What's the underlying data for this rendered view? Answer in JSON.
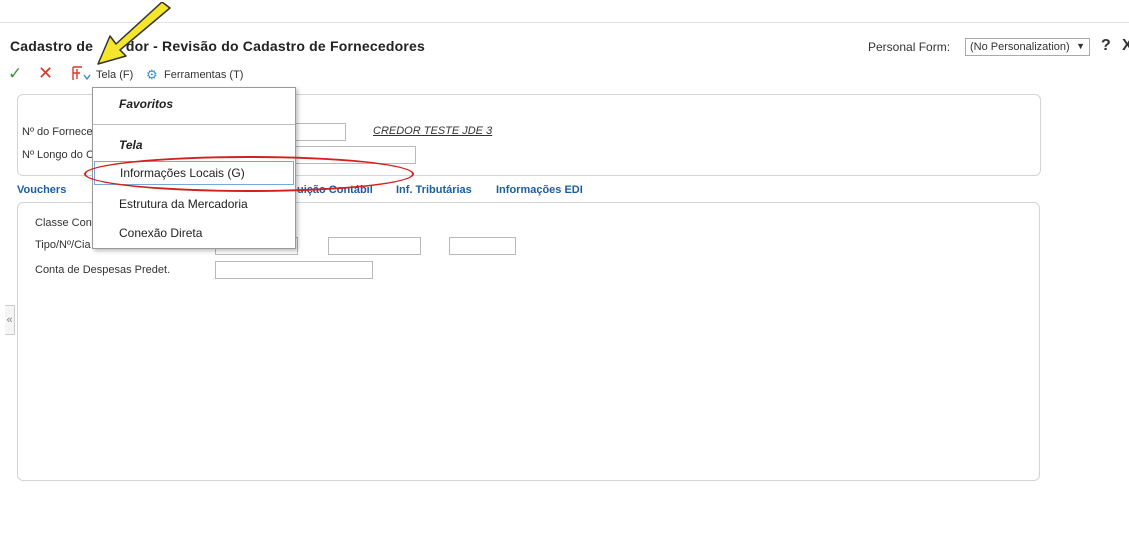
{
  "window": {
    "title": "Cadastro de Credor - Revisão do Cadastro de Fornecedores",
    "title_visible": "Cadastro de        dor - Revisão do Cadastro de Fornecedores",
    "personal_form_label": "Personal Form:",
    "personal_form_value": "(No Personalization)",
    "help": "?",
    "close": "X"
  },
  "toolbar": {
    "ok_icon": "checkmark-icon",
    "cancel_icon": "x-icon",
    "form_icon": "form-exit-icon",
    "tela_label": "Tela (F)",
    "tools_icon": "gear-icon",
    "tools_label": "Ferramentas (T)"
  },
  "header": {
    "supplier_number_label": "Nº do Fornece",
    "supplier_name_link": "CREDOR TESTE JDE 3",
    "long_number_label": "Nº Longo do C"
  },
  "tabs": [
    {
      "label": "Vouchers"
    },
    {
      "label": "uição Contábil"
    },
    {
      "label": "Inf. Tributárias"
    },
    {
      "label": "Informações EDI"
    }
  ],
  "content": {
    "class_label": "Classe Con",
    "type_label": "Tipo/Nº/Cia",
    "expense_account_label": "Conta de Despesas Predet."
  },
  "menu": {
    "section_favorites": "Favoritos",
    "section_tela": "Tela",
    "items": [
      {
        "label": "Informações Locais (G)"
      },
      {
        "label": "Estrutura da Mercadoria"
      },
      {
        "label": "Conexão Direta"
      }
    ]
  },
  "annotation": {
    "arrow_color": "#f5e52b",
    "ellipse_color": "#d32020"
  },
  "sidebar": {
    "collapse_glyph": "«"
  }
}
